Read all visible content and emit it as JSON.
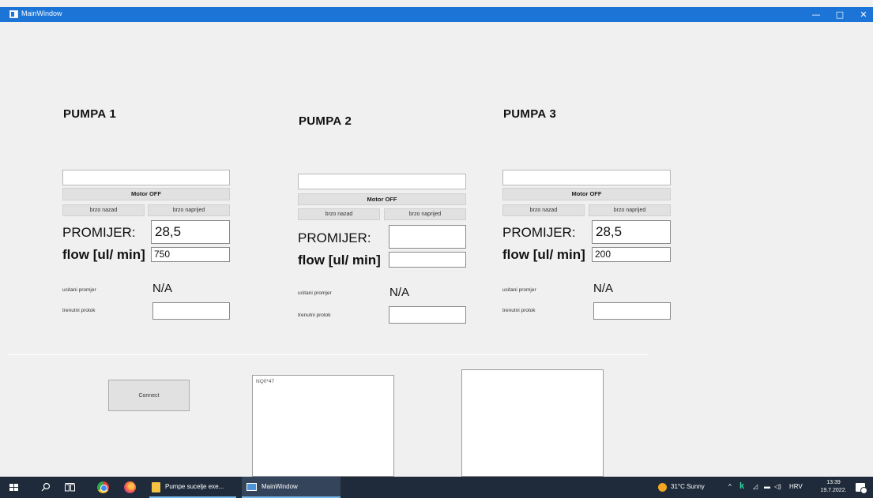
{
  "window": {
    "title": "MainWindow",
    "minimize_glyph": "—",
    "maximize_glyph": "□",
    "close_glyph": "✕"
  },
  "pumps": [
    {
      "title": "PUMPA 1",
      "text_field": "",
      "motor_label": "Motor OFF",
      "back_label": "brzo nazad",
      "forward_label": "brzo naprijed",
      "diameter_label": "PROMIJER:",
      "diameter_value": "28,5",
      "flow_label": "flow [ul/ min]",
      "flow_value": "750",
      "read_diameter_label": "ucitani promjer",
      "read_diameter_value": "N/A",
      "current_flow_label": "trenutni protok",
      "current_flow_value": ""
    },
    {
      "title": "PUMPA 2",
      "text_field": "",
      "motor_label": "Motor OFF",
      "back_label": "brzo nazad",
      "forward_label": "brzo naprijed",
      "diameter_label": "PROMIJER:",
      "diameter_value": "",
      "flow_label": "flow [ul/ min]",
      "flow_value": "",
      "read_diameter_label": "ucitani promjer",
      "read_diameter_value": "N/A",
      "current_flow_label": "trenutni protok",
      "current_flow_value": ""
    },
    {
      "title": "PUMPA 3",
      "text_field": "",
      "motor_label": "Motor OFF",
      "back_label": "brzo nazad",
      "forward_label": "brzo naprijed",
      "diameter_label": "PROMIJER:",
      "diameter_value": "28,5",
      "flow_label": "flow [ul/ min]",
      "flow_value": "200",
      "read_diameter_label": "ucitani promjer",
      "read_diameter_value": "N/A",
      "current_flow_label": "trenutni protok",
      "current_flow_value": ""
    }
  ],
  "bottom": {
    "connect_label": "Connect",
    "console_text": "NQ0*47",
    "output_text": ""
  },
  "taskbar": {
    "folder_app_label": "Pumpe sucelje exe...",
    "active_app_label": "MainWindow",
    "weather": "31°C  Sunny",
    "tray_glyphs": "^  k  ",
    "language": "HRV",
    "time": "13:39",
    "date": "19.7.2022."
  },
  "colors": {
    "titlebar": "#1b74d6",
    "taskbar": "#1f2b3a",
    "window_bg": "#f0f0f0"
  }
}
